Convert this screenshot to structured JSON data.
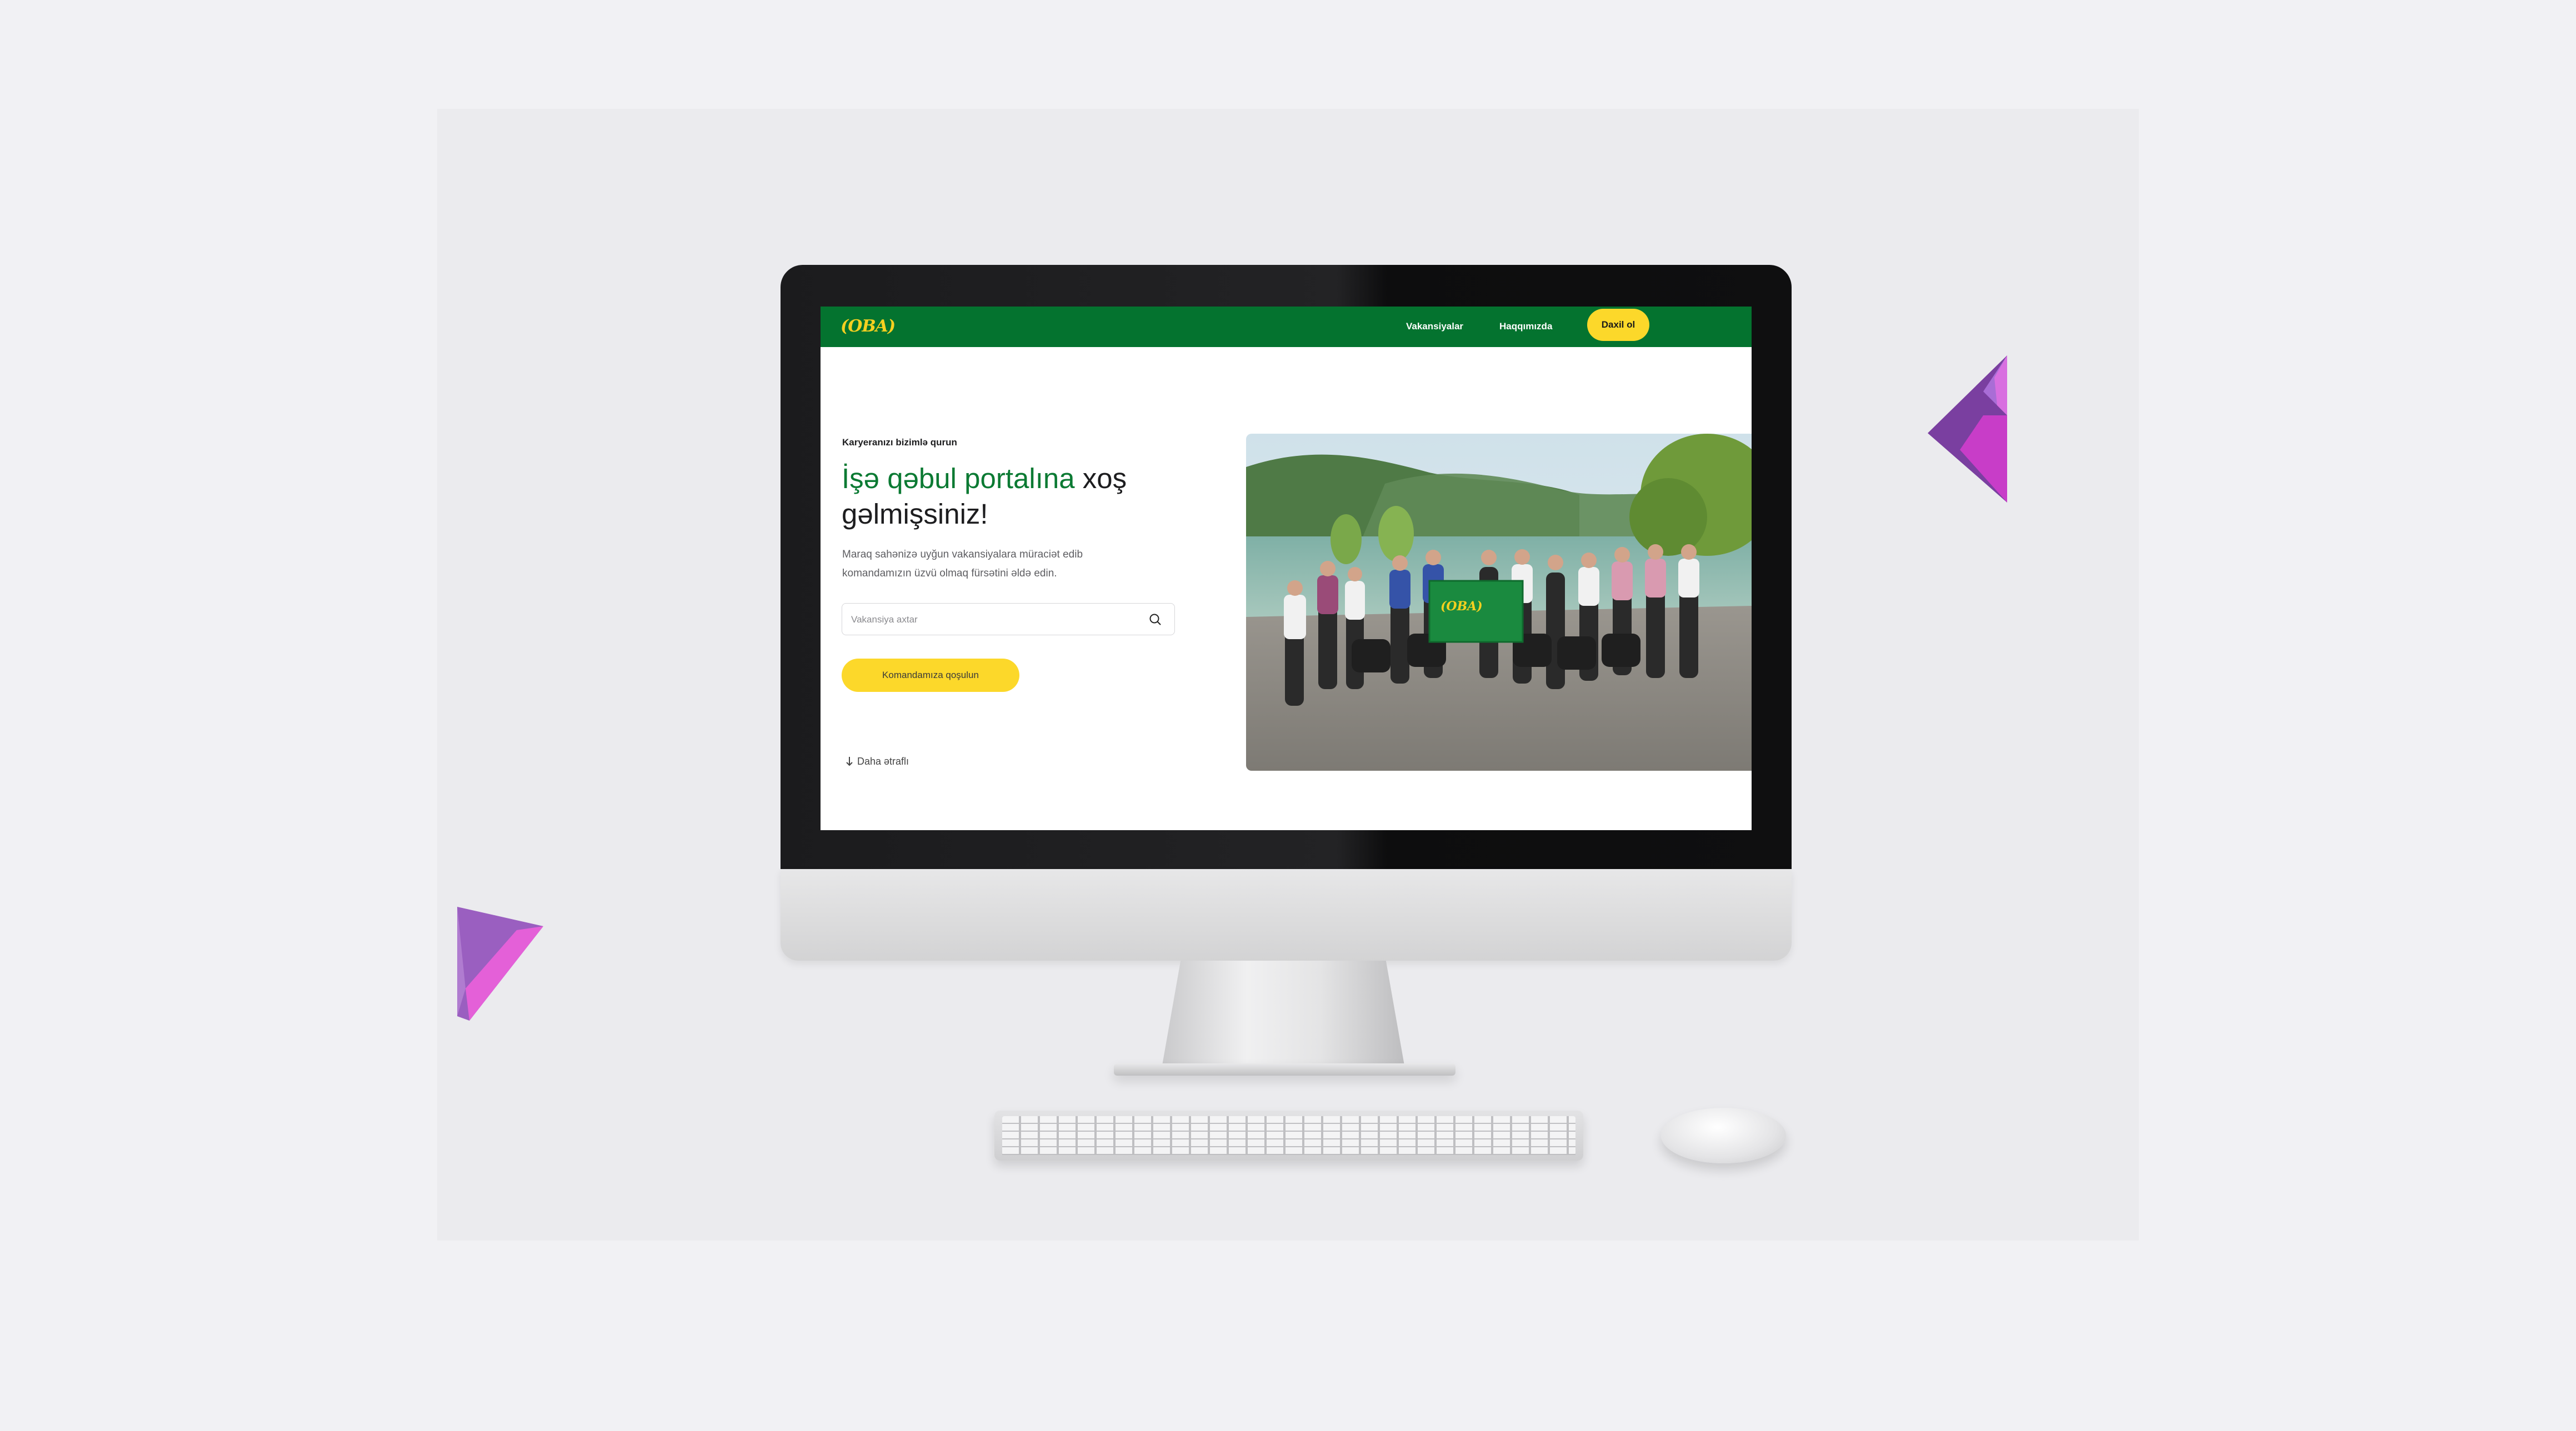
{
  "header": {
    "logo_text": "(OBA)",
    "nav": {
      "vacancies": "Vakansiyalar",
      "about": "Haqqımızda",
      "login": "Daxil ol"
    }
  },
  "hero": {
    "eyebrow": "Karyeranızı bizimlə qurun",
    "title_green": "İşə qəbul portalına",
    "title_dark_1": " xoş",
    "title_dark_2": "gəlmişsiniz!",
    "description": "Maraq sahənizə uyğun vakansiyalara müraciət edib komandamızın üzvü olmaq fürsətini əldə edin.",
    "search": {
      "placeholder": "Vakansiya axtar",
      "value": ""
    },
    "join_button": "Komandamıza qoşulun",
    "more_link": "Daha ətraflı"
  },
  "photo": {
    "banner_text": "(OBA)"
  },
  "colors": {
    "brand_green": "#04732f",
    "headline_green": "#0b7a33",
    "accent_yellow": "#fcd82a",
    "background": "#f1f1f4"
  },
  "icons": {
    "search": "search-icon",
    "arrow": "arrow-down-icon",
    "gems": "decorative-gem-icon"
  }
}
